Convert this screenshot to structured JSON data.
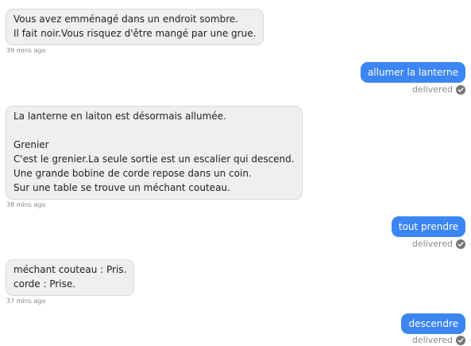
{
  "messages": {
    "m1": {
      "lines": [
        "Vous avez emménagé dans un endroit sombre.",
        "Il fait noir.Vous risquez d'être mangé par une grue."
      ],
      "time": "39 mins ago"
    },
    "o1": {
      "text": "allumer la lanterne",
      "status": "delivered"
    },
    "m2": {
      "lines": [
        "La lanterne en laiton est désormais allumée.",
        "",
        "Grenier",
        "C'est le grenier.La seule sortie est un escalier qui descend.",
        "Une grande bobine de corde repose dans un coin.",
        "Sur une table se trouve un méchant couteau."
      ],
      "time": "38 mins ago"
    },
    "o2": {
      "text": "tout prendre",
      "status": "delivered"
    },
    "m3": {
      "lines": [
        "méchant couteau : Pris.",
        "corde : Prise."
      ],
      "time": "37 mins ago"
    },
    "o3": {
      "text": "descendre",
      "status": "delivered"
    }
  },
  "icons": {
    "delivered": "check-circle-icon"
  },
  "colors": {
    "outgoing_bubble": "#3c86f4",
    "incoming_bubble": "#efefef",
    "meta_text": "#888888"
  }
}
